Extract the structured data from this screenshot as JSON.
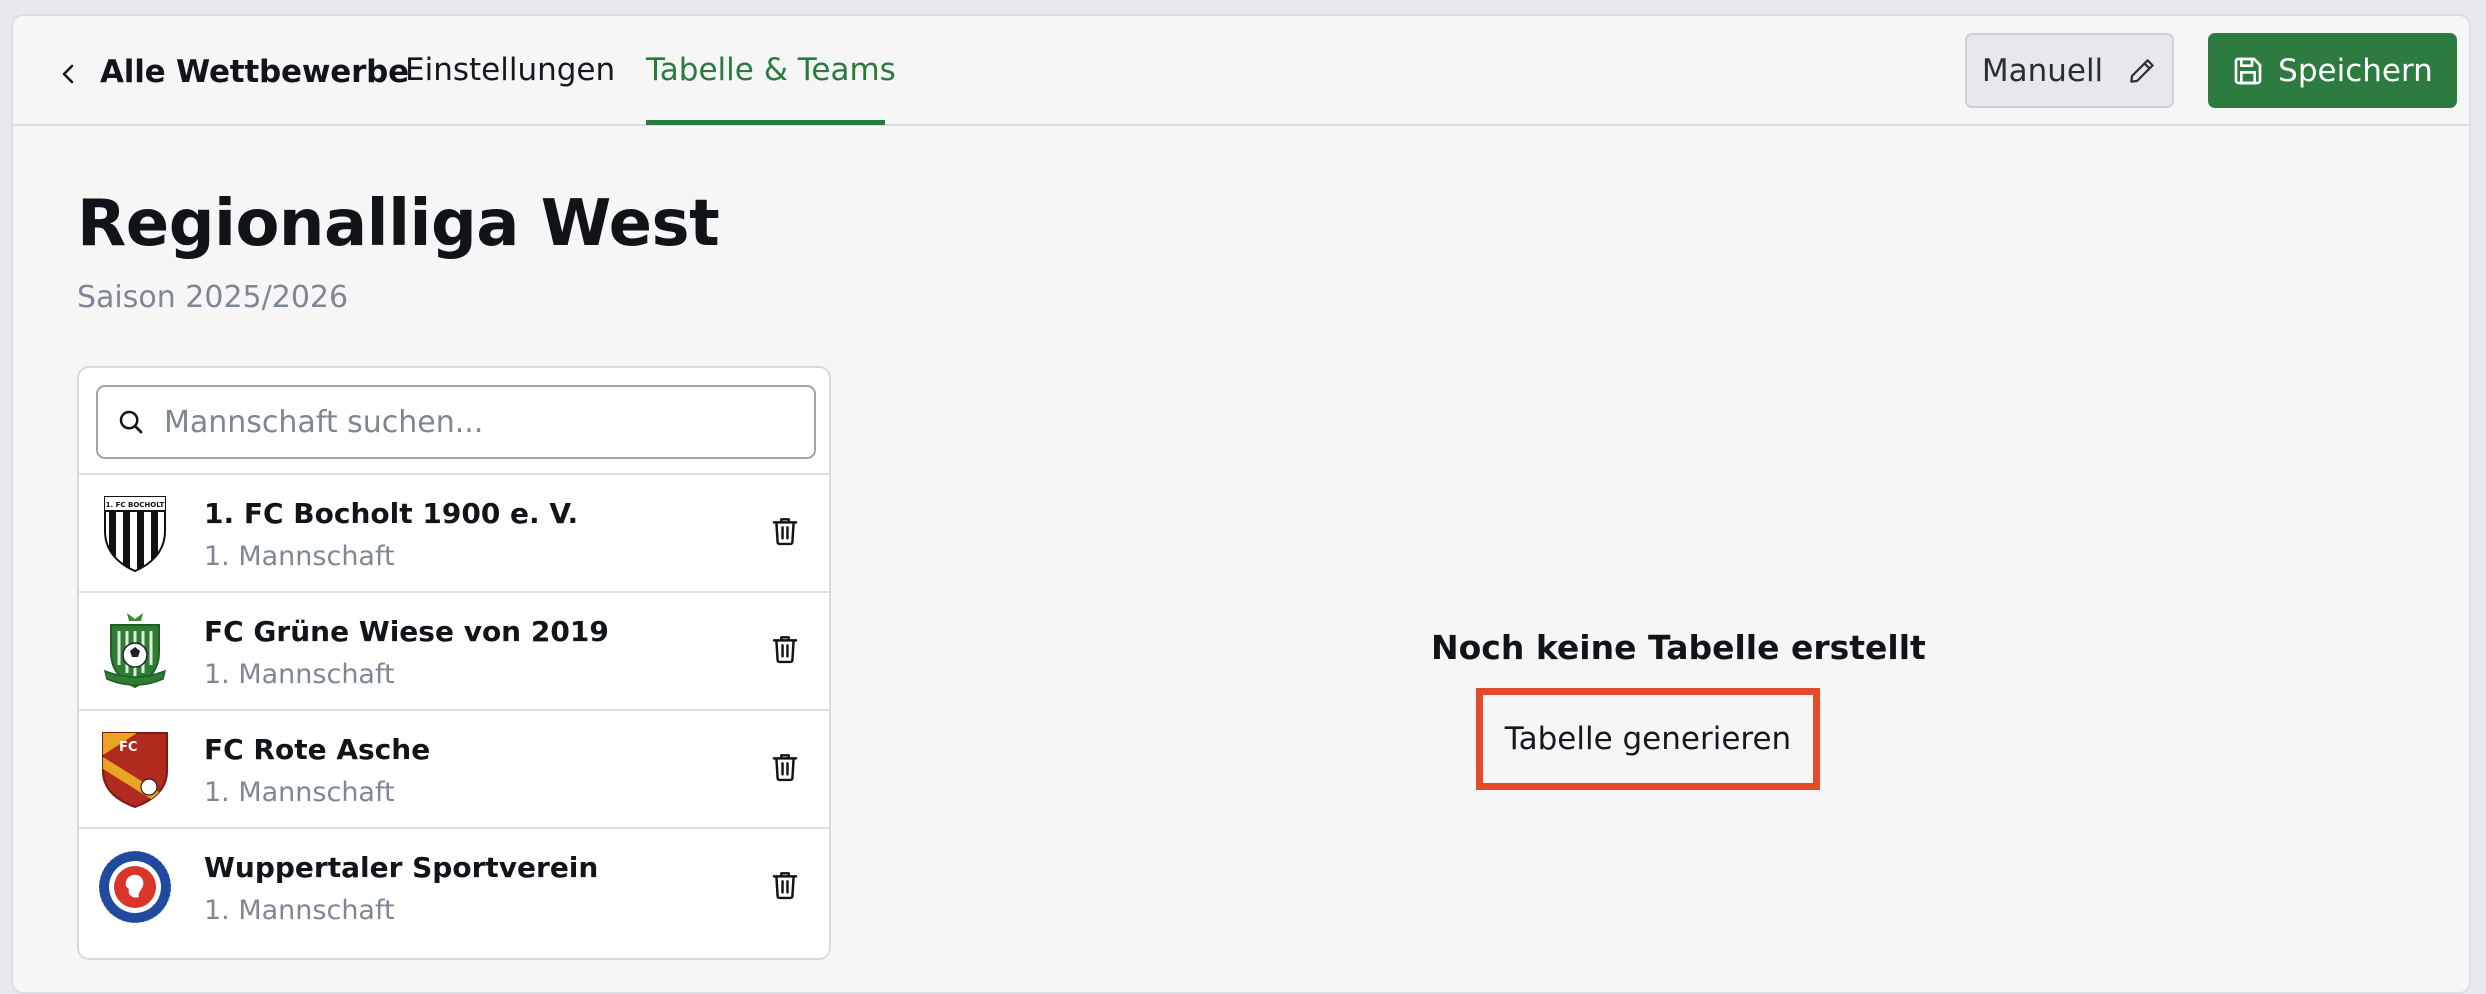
{
  "header": {
    "back_label": "Alle Wettbewerbe",
    "tabs": [
      {
        "label": "Einstellungen",
        "active": false
      },
      {
        "label": "Tabelle & Teams",
        "active": true
      }
    ],
    "mode_label": "Manuell",
    "save_label": "Speichern"
  },
  "competition": {
    "title": "Regionalliga West",
    "season": "Saison 2025/2026"
  },
  "search": {
    "placeholder": "Mannschaft suchen...",
    "value": ""
  },
  "teams": [
    {
      "name": "1. FC Bocholt 1900 e. V.",
      "subtitle": "1. Mannschaft",
      "logo": "bocholt-crest",
      "logo_text": "1. FC BOCHOLT"
    },
    {
      "name": "FC Grüne Wiese von 2019",
      "subtitle": "1. Mannschaft",
      "logo": "gruene-wiese-crest"
    },
    {
      "name": "FC Rote Asche",
      "subtitle": "1. Mannschaft",
      "logo": "rote-asche-crest",
      "logo_text": "FC"
    },
    {
      "name": "Wuppertaler Sportverein",
      "subtitle": "1. Mannschaft",
      "logo": "wuppertal-crest"
    }
  ],
  "empty_state": {
    "title": "Noch keine Tabelle erstellt",
    "action_label": "Tabelle generieren"
  },
  "colors": {
    "accent": "#2e7b41",
    "highlight": "#e54a2d",
    "muted_text": "#7f8694"
  }
}
